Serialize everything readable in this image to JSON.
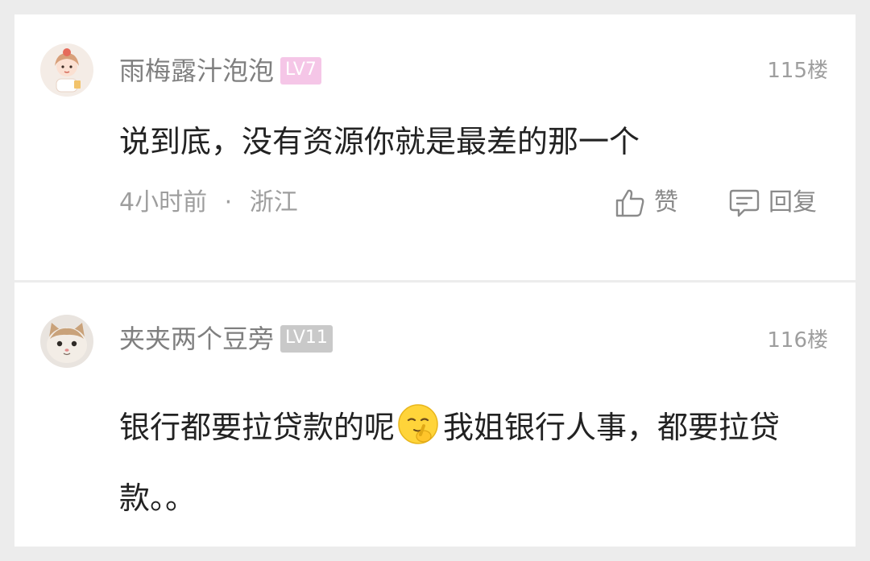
{
  "comments": [
    {
      "username": "雨梅露汁泡泡",
      "level": "LV7",
      "floor": "115楼",
      "text": "说到底，没有资源你就是最差的那一个",
      "time": "4小时前",
      "separator": "·",
      "location": "浙江",
      "like_label": "赞",
      "reply_label": "回复",
      "avatar_icon": "girl-avatar",
      "level_color": "#f5c6e7"
    },
    {
      "username": "夹夹两个豆旁",
      "level": "LV11",
      "floor": "116楼",
      "text_part1": "银行都要拉贷款的呢",
      "emoji": "shushing-face-emoji",
      "text_part2": "我姐银行人事，都要拉贷款。。",
      "avatar_icon": "cat-avatar",
      "level_color": "#c9c9c9"
    }
  ],
  "colors": {
    "background": "#ececec",
    "card": "#ffffff",
    "username": "#7f7f7f",
    "meta": "#9e9e9e",
    "text": "#222222"
  }
}
